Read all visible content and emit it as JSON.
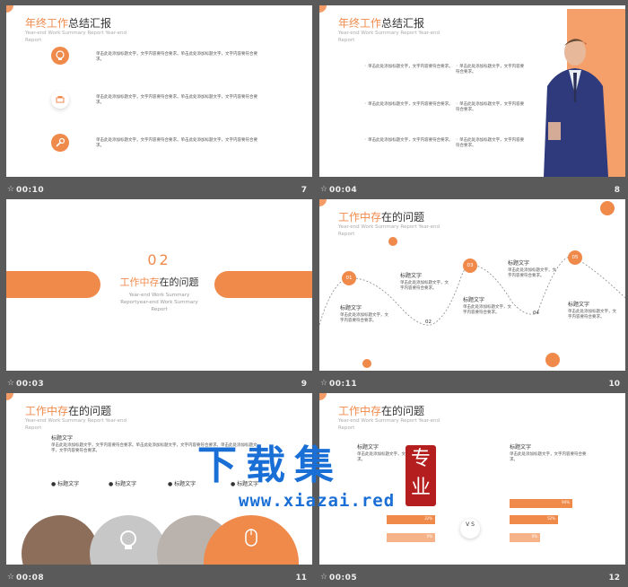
{
  "slides": [
    {
      "time": "00:10",
      "num": "7",
      "title_orange": "年终工作",
      "title_dark": "总结汇报",
      "subtitle": "Year-end  Work  Summary  Report  Year-end Report",
      "items": [
        "单击此处添加标题文字，文字内容要符合要求。单击此处添加标题文字，文字内容要符合要求。",
        "单击此处添加标题文字，文字内容要符合要求。单击此处添加标题文字，文字内容要符合要求。",
        "单击此处添加标题文字，文字内容要符合要求。单击此处添加标题文字，文字内容要符合要求。"
      ]
    },
    {
      "time": "00:04",
      "num": "8",
      "title_orange": "年终工作",
      "title_dark": "总结汇报",
      "subtitle": "Year-end  Work  Summary  Report  Year-end Report",
      "items": [
        "单击此处添加标题文字，文字内容要符合要求。",
        "单击此处添加标题文字，文字内容要符合要求。",
        "单击此处添加标题文字，文字内容要符合要求。"
      ],
      "items2": [
        "单击此处添加标题文字，文字内容要符合要求。",
        "单击此处添加标题文字，文字内容要符合要求。",
        "单击此处添加标题文字，文字内容要符合要求。"
      ]
    },
    {
      "time": "00:03",
      "num": "9",
      "section_num": "02",
      "title_orange": "工作中存",
      "title_dark": "在的问题",
      "subtitle": "Year-end  Work  Summary Reportyear-end  Work  Summary Report"
    },
    {
      "time": "00:11",
      "num": "10",
      "title_orange": "工作中存",
      "title_dark": "在的问题",
      "subtitle": "Year-end  Work  Summary  Report  Year-end Report",
      "points": [
        "01",
        "02",
        "03",
        "04",
        "05"
      ],
      "heading": "标题文字",
      "text": "单击此处添加标题文字，文字内容要符合要求。"
    },
    {
      "time": "00:08",
      "num": "11",
      "title_orange": "工作中存",
      "title_dark": "在的问题",
      "subtitle": "Year-end  Work  Summary  Report  Year-end Report",
      "heading": "标题文字",
      "text": "单击此处添加标题文字，文字内容要符合要求。单击此处添加标题文字，文字内容要符合要求。单击此处添加标题文字，文字内容要符合要求。",
      "bullets": [
        "标题文字",
        "标题文字",
        "标题文字",
        "标题文字"
      ]
    },
    {
      "time": "00:05",
      "num": "12",
      "title_orange": "工作中存",
      "title_dark": "在的问题",
      "subtitle": "Year-end  Work  Summary  Report  Year-end Report",
      "heading": "标题文字",
      "text": "单击此处添加标题文字，文字内容要符合要求。",
      "vs": "V S",
      "bars_left": [
        {
          "value": "32%"
        },
        {
          "value": "0%"
        }
      ],
      "bars_right": [
        {
          "value": "94%"
        },
        {
          "value": "52%"
        },
        {
          "value": "0%"
        }
      ]
    }
  ],
  "watermark": {
    "main": "下载集",
    "seal": "专业",
    "url": "www.xiazai.red"
  },
  "colors": {
    "accent": "#f08a4b",
    "background": "#5a5a5a"
  }
}
